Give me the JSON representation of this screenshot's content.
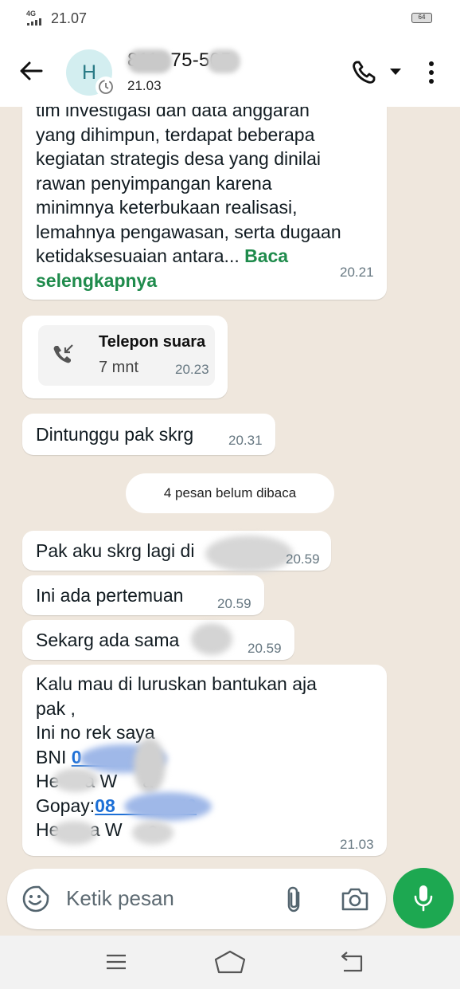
{
  "status_bar": {
    "network": "4G",
    "time": "21.07",
    "battery": "64"
  },
  "header": {
    "avatar_initial": "H",
    "contact_name": "   811-  75-505",
    "contact_subtitle": "21.03"
  },
  "messages": [
    {
      "text": "tim investigasi dan data anggaran\nyang dihimpun, terdapat beberapa\nkegiatan strategis desa yang dinilai\nrawan penyimpangan karena\nminimnya keterbukaan realisasi,\nlemahnya pengawasan, serta dugaan\nketidaksesuaian antara... ",
      "read_more": "Baca\nselengkapnya",
      "time": "20.21"
    },
    {
      "call_title": "Telepon suara",
      "call_duration": "7 mnt",
      "time": "20.23"
    },
    {
      "text": "Dintunggu pak skrg",
      "time": "20.31"
    },
    {
      "text": "Pak aku skrg lagi di",
      "time": "20.59"
    },
    {
      "text": "Ini ada pertemuan",
      "time": "20.59"
    },
    {
      "text": "Sekarg ada sama",
      "time": "20.59"
    },
    {
      "line1": "Kalu mau di luruskan bantukan aja",
      "line2": "pak ,",
      "line3": "Ini no rek saya",
      "bni_label": "BNI ",
      "bni_number": "0          94",
      "name1": "He     a W     a",
      "gopay_label": "Gopay:",
      "gopay_number": "08            50",
      "name2": "He      a W     a",
      "time": "21.03"
    }
  ],
  "unread_divider": "4 pesan belum dibaca",
  "composer": {
    "placeholder": "Ketik pesan"
  },
  "colors": {
    "chat_background": "#efe7dd",
    "bubble": "#ffffff",
    "accent_green": "#1da851",
    "read_more_green": "#1f8b4c",
    "link_blue": "#1c6fd6"
  },
  "icons": [
    "back-arrow-icon",
    "phone-icon",
    "dropdown-caret-icon",
    "more-vert-icon",
    "incoming-call-icon",
    "emoji-icon",
    "paperclip-icon",
    "camera-icon",
    "microphone-icon",
    "nav-menu-icon",
    "nav-home-icon",
    "nav-back-icon"
  ]
}
